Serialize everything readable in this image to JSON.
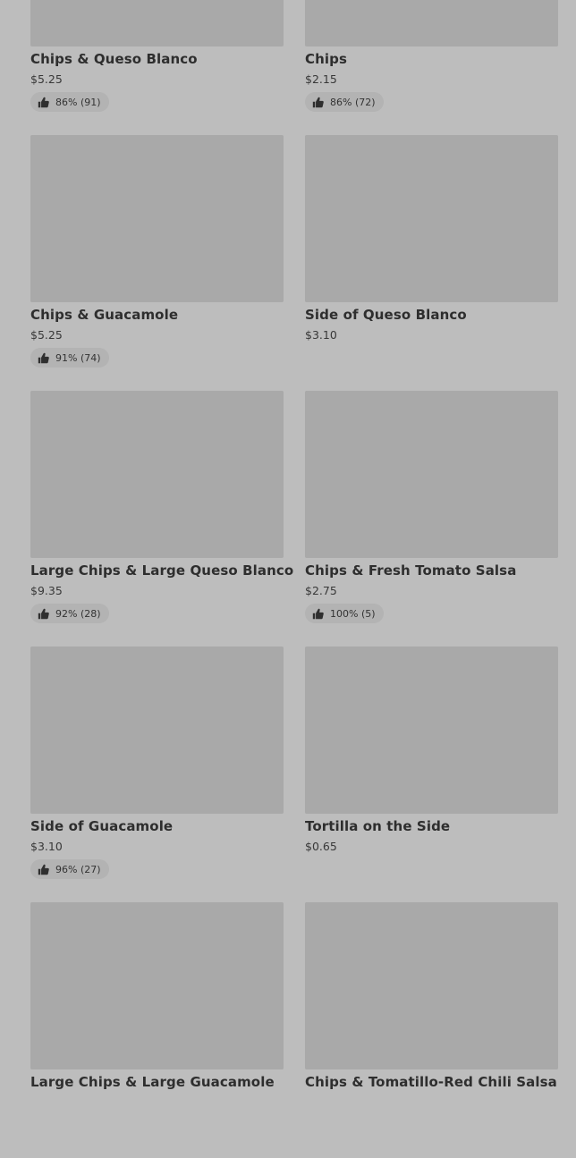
{
  "menu_items": [
    {
      "name": "Chips & Queso Blanco",
      "price": "$5.25",
      "rating": "86% (91)"
    },
    {
      "name": "Chips",
      "price": "$2.15",
      "rating": "86% (72)"
    },
    {
      "name": "Chips & Guacamole",
      "price": "$5.25",
      "rating": "91% (74)"
    },
    {
      "name": "Side of Queso Blanco",
      "price": "$3.10",
      "rating": null
    },
    {
      "name": "Large Chips & Large Queso Blanco",
      "price": "$9.35",
      "rating": "92% (28)"
    },
    {
      "name": "Chips & Fresh Tomato Salsa",
      "price": "$2.75",
      "rating": "100% (5)"
    },
    {
      "name": "Side of Guacamole",
      "price": "$3.10",
      "rating": "96% (27)"
    },
    {
      "name": "Tortilla on the Side",
      "price": "$0.65",
      "rating": null
    },
    {
      "name": "Large Chips & Large Guacamole",
      "price": "",
      "rating": null
    },
    {
      "name": "Chips & Tomatillo-Red Chili Salsa",
      "price": "",
      "rating": null
    }
  ],
  "icons": {
    "rating": "thumbs-up-icon"
  },
  "colors": {
    "background": "#bdbdbd",
    "image_placeholder": "#a9a9a9",
    "rating_pill": "#b3b3b3",
    "text": "#2f2f2f"
  }
}
